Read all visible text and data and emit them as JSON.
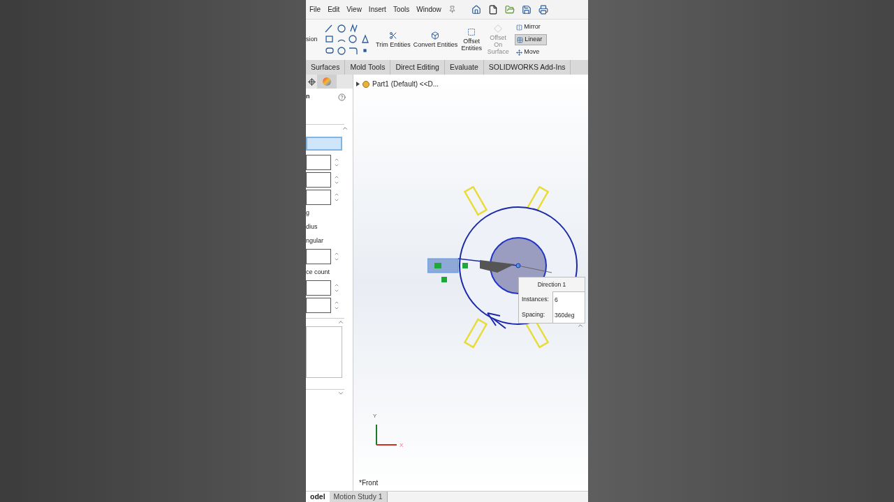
{
  "menu": [
    "File",
    "Edit",
    "View",
    "Insert",
    "Tools",
    "Window"
  ],
  "ribbon": {
    "cut_label": "sion",
    "buttons": [
      {
        "label": "Trim Entities",
        "disabled": false
      },
      {
        "label": "Convert Entities",
        "disabled": false
      },
      {
        "label": "Offset Entities",
        "disabled": false
      },
      {
        "label": "Offset On Surface",
        "disabled": true
      }
    ],
    "side_buttons": [
      {
        "label": "Mirror",
        "selected": false
      },
      {
        "label": "Linear",
        "selected": true
      },
      {
        "label": "Move",
        "selected": false
      }
    ]
  },
  "tabs": [
    {
      "label": "Surfaces",
      "selected": false
    },
    {
      "label": "Mold Tools",
      "selected": false
    },
    {
      "label": "Direct Editing",
      "selected": false
    },
    {
      "label": "Evaluate",
      "selected": false
    },
    {
      "label": "SOLIDWORKS Add-Ins",
      "selected": false
    }
  ],
  "panel": {
    "title": "n",
    "items": [
      {
        "kind": "field",
        "highlighted": true
      },
      {
        "kind": "spinner"
      },
      {
        "kind": "spinner"
      },
      {
        "kind": "spinner"
      },
      {
        "kind": "text",
        "label": "g"
      },
      {
        "kind": "text",
        "label": "dius"
      },
      {
        "kind": "text",
        "label": "ngular"
      },
      {
        "kind": "spinner"
      },
      {
        "kind": "text",
        "label": "ce count"
      },
      {
        "kind": "spinner"
      },
      {
        "kind": "spinner"
      }
    ]
  },
  "tree": {
    "label": "Part1 (Default) <<D..."
  },
  "popup": {
    "title": "Direction 1",
    "rows": [
      {
        "label": "Instances:",
        "value": "6"
      },
      {
        "label": "Spacing:",
        "value": "360deg"
      }
    ]
  },
  "axes": [
    "Y",
    "X"
  ],
  "view_label": "*Front",
  "bottom_tabs": [
    {
      "label": "odel",
      "selected": true
    },
    {
      "label": "Motion Study 1",
      "selected": false
    }
  ]
}
